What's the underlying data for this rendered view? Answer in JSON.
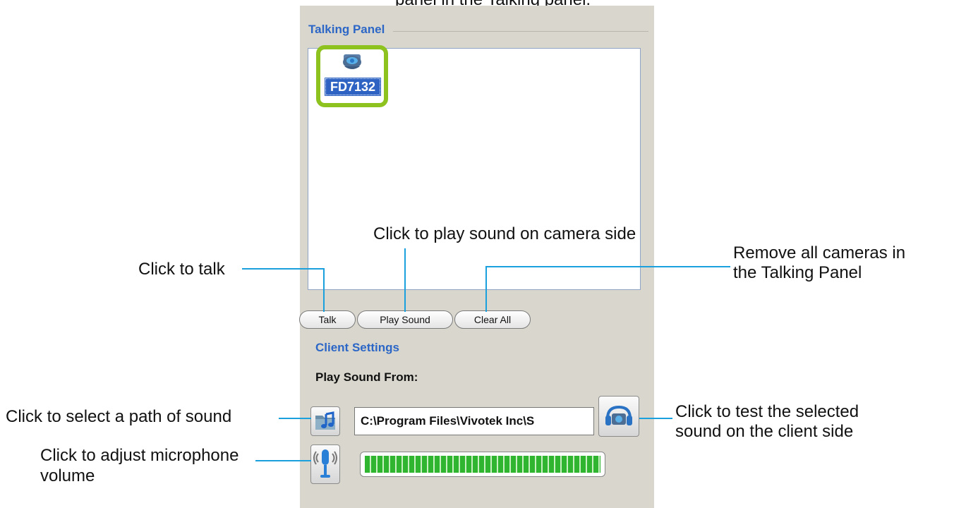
{
  "top_caption": "panel in the Talking panel.",
  "talking_panel": {
    "title": "Talking Panel",
    "camera_label": "FD7132",
    "buttons": {
      "talk": "Talk",
      "play_sound": "Play Sound",
      "clear_all": "Clear All"
    }
  },
  "client_settings": {
    "title": "Client Settings",
    "play_sound_from_label": "Play Sound From:",
    "path_value": "C:\\Program Files\\Vivotek Inc\\S",
    "volume_level": 1.0
  },
  "annotations": {
    "talk": "Click to talk",
    "play_sound": "Click to play sound on camera side",
    "clear_all_line1": "Remove all cameras in",
    "clear_all_line2": "the Talking Panel",
    "select_path": "Click to select a path of sound",
    "mic_line1": "Click to adjust microphone",
    "mic_line2": "volume",
    "test_line1": "Click to test the selected",
    "test_line2": "sound on the client side"
  },
  "colors": {
    "accent": "#2c66c6",
    "selection_ring": "#8dc21f",
    "leader_line": "#1aa0dd",
    "volume_fill": "#2fb52f"
  }
}
